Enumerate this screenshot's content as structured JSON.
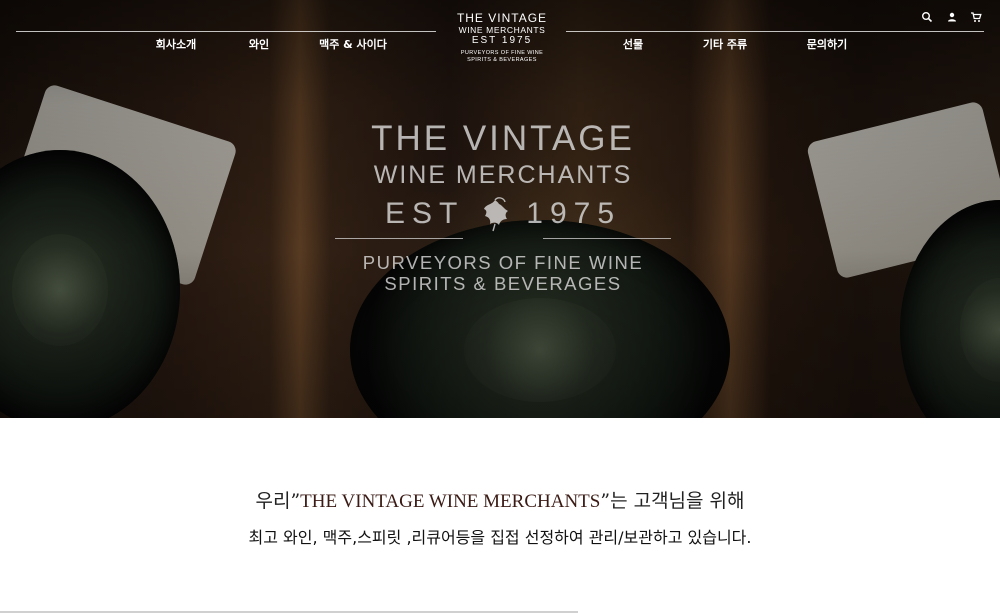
{
  "nav": {
    "left_items": [
      {
        "label": "회사소개"
      },
      {
        "label": "와인"
      },
      {
        "label": "맥주 & 사이다"
      }
    ],
    "right_items": [
      {
        "label": "선물"
      },
      {
        "label": "기타 주류"
      },
      {
        "label": "문의하기"
      }
    ],
    "logo": {
      "line1": "THE VINTAGE",
      "line2": "WINE MERCHANTS",
      "line3": "EST  1975",
      "line4": "PURVEYORS OF FINE WINE",
      "line5": "SPIRITS & BEVERAGES"
    },
    "icons": [
      "search-icon",
      "user-icon",
      "cart-icon"
    ]
  },
  "hero": {
    "logo": {
      "line1": "THE VINTAGE",
      "line2": "WINE MERCHANTS",
      "est_left": "EST",
      "est_right": "1975",
      "line4": "PURVEYORS OF FINE WINE",
      "line5": "SPIRITS & BEVERAGES"
    }
  },
  "intro": {
    "line1_prefix": "우리”",
    "line1_brand": "THE VINTAGE WINE MERCHANTS",
    "line1_suffix": "”는 고객님을 위해",
    "line2": "최고 와인, 맥주,스피릿 ,리큐어등을 집접 선정하여 관리/보관하고 있습니다."
  },
  "colors": {
    "brand_text": "#3a1a14",
    "nav_text": "#ffffff"
  }
}
